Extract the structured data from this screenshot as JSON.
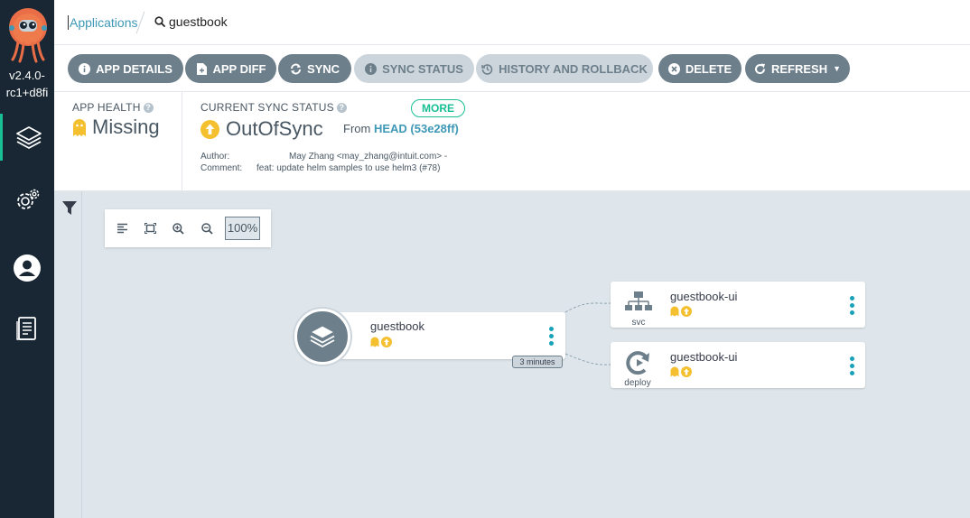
{
  "sidebar": {
    "version": "v2.4.0-rc1+d8fi",
    "version_line1": "v2.4.0-",
    "version_line2": "rc1+d8fi",
    "items": [
      {
        "name": "applications",
        "icon": "layers-icon"
      },
      {
        "name": "settings",
        "icon": "gear-icon"
      },
      {
        "name": "user-info",
        "icon": "user-icon"
      },
      {
        "name": "docs",
        "icon": "docs-icon"
      }
    ]
  },
  "breadcrumb": {
    "applications": "Applications",
    "current": "guestbook"
  },
  "toolbar": {
    "app_details": "APP DETAILS",
    "app_diff": "APP DIFF",
    "sync": "SYNC",
    "sync_status": "SYNC STATUS",
    "history": "HISTORY AND ROLLBACK",
    "delete": "DELETE",
    "refresh": "REFRESH"
  },
  "status": {
    "app_health_label": "APP HEALTH",
    "app_health_value": "Missing",
    "sync_label": "CURRENT SYNC STATUS",
    "sync_value": "OutOfSync",
    "more": "MORE",
    "from_prefix": "From",
    "revision": "HEAD (53e28ff)",
    "author_label": "Author:",
    "author_value": "May Zhang <may_zhang@intuit.com> -",
    "comment_label": "Comment:",
    "comment_value": "feat: update helm samples to use helm3 (#78)"
  },
  "canvas": {
    "zoom": "100%",
    "nodes": [
      {
        "name": "guestbook",
        "kind": "application"
      },
      {
        "name": "guestbook-ui",
        "kind": "svc"
      },
      {
        "name": "guestbook-ui",
        "kind": "deploy"
      }
    ],
    "age_badge": "3 minutes"
  },
  "colors": {
    "sidebar_bg": "#182733",
    "accent_teal": "#18be94",
    "link_blue": "#3e98b6",
    "button_gray": "#6d7f8b",
    "missing_yellow": "#f4c030",
    "canvas_bg": "#dee6eb"
  }
}
